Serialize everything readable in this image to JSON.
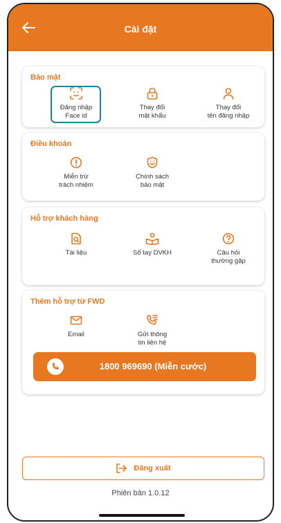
{
  "header": {
    "title": "Cài đặt"
  },
  "security": {
    "title": "Bảo mật",
    "items": [
      {
        "line1": "Đăng nhập",
        "line2": "Face id",
        "icon": "face-scan-icon"
      },
      {
        "line1": "Thay đổi",
        "line2": "mật khẩu",
        "icon": "lock-icon"
      },
      {
        "line1": "Thay đổi",
        "line2": "tên đăng nhập",
        "icon": "user-icon"
      }
    ]
  },
  "terms": {
    "title": "Điều khoản",
    "items": [
      {
        "line1": "Miễn trừ",
        "line2": "trách nhiệm",
        "icon": "alert-circle-icon"
      },
      {
        "line1": "Chính sách",
        "line2": "bảo mật",
        "icon": "privacy-shield-icon"
      }
    ]
  },
  "support": {
    "title": "Hỗ trợ khách hàng",
    "items": [
      {
        "line1": "Tài liệu",
        "line2": "",
        "icon": "document-search-icon"
      },
      {
        "line1": "Sổ tay DVKH",
        "line2": "",
        "icon": "handbook-icon"
      },
      {
        "line1": "Câu hỏi",
        "line2": "thường gặp",
        "icon": "question-circle-icon"
      }
    ]
  },
  "more_support": {
    "title": "Thêm hỗ trợ từ FWD",
    "items": [
      {
        "line1": "Email",
        "line2": "",
        "icon": "mail-icon"
      },
      {
        "line1": "Gửi thông",
        "line2": "tin liên hệ",
        "icon": "contact-phone-icon"
      }
    ],
    "hotline": "1800 969690 (Miễn cước)"
  },
  "logout_label": "Đăng xuất",
  "version": "Phiên bản 1.0.12",
  "colors": {
    "accent": "#e87722",
    "focus": "#17839c"
  }
}
